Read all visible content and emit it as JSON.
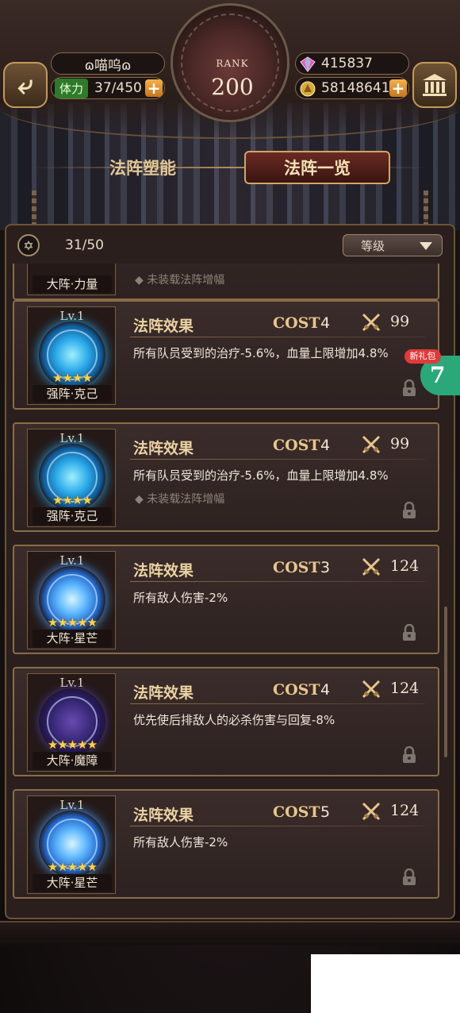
{
  "header": {
    "player_name": "ɷ喵呜ɷ",
    "stamina_label": "体力",
    "stamina_value": "37/450",
    "rank_label": "RANK",
    "rank_value": "200",
    "gems": "415837",
    "gold": "58148641",
    "plus_symbol": "+"
  },
  "tabs": [
    {
      "label": "法阵塑能",
      "active": false
    },
    {
      "label": "法阵一览",
      "active": true
    }
  ],
  "panel": {
    "count": "31/50",
    "sort_label": "等级"
  },
  "partial_card": {
    "name": "大阵·力量",
    "amp": "未装载法阵增幅"
  },
  "cards": [
    {
      "lv": "Lv.1",
      "stars": "★★★★",
      "name": "强阵·克己",
      "title": "法阵效果",
      "cost_label": "COST",
      "cost": "4",
      "power": "99",
      "effect": "所有队员受到的治疗-5.6%，血量上限增加4.8%",
      "amp": "",
      "style": "blue"
    },
    {
      "lv": "Lv.1",
      "stars": "★★★★",
      "name": "强阵·克己",
      "title": "法阵效果",
      "cost_label": "COST",
      "cost": "4",
      "power": "99",
      "effect": "所有队员受到的治疗-5.6%，血量上限增加4.8%",
      "amp": "未装载法阵增幅",
      "style": "blue"
    },
    {
      "lv": "Lv.1",
      "stars": "★★★★★",
      "name": "大阵·星芒",
      "title": "法阵效果",
      "cost_label": "COST",
      "cost": "3",
      "power": "124",
      "effect": "所有敌人伤害-2%",
      "amp": "",
      "style": "star"
    },
    {
      "lv": "Lv.1",
      "stars": "★★★★★",
      "name": "大阵·魔障",
      "title": "法阵效果",
      "cost_label": "COST",
      "cost": "4",
      "power": "124",
      "effect": "优先使后排敌人的必杀伤害与回复-8%",
      "amp": "",
      "style": "dark"
    },
    {
      "lv": "Lv.1",
      "stars": "★★★★★",
      "name": "大阵·星芒",
      "title": "法阵效果",
      "cost_label": "COST",
      "cost": "5",
      "power": "124",
      "effect": "所有敌人伤害-2%",
      "amp": "",
      "style": "star"
    }
  ],
  "gift": {
    "badge": "新礼包",
    "ball": "7"
  },
  "colors": {
    "accent_gold": "#c49a5a",
    "active_tab": "#6a2a22",
    "star": "#ffd24a"
  }
}
